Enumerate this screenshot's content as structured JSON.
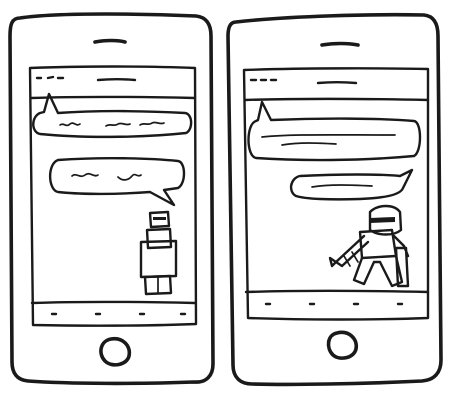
{
  "sketch": {
    "ink_color": "#1a1a1a",
    "paper_color": "#ffffff",
    "phones": [
      {
        "id": "left",
        "chat_bubbles": [
          {
            "side": "left",
            "has_scribble": true
          },
          {
            "side": "right",
            "has_scribble": true
          }
        ],
        "figure": "person-standing",
        "nav_dots": 4
      },
      {
        "id": "right",
        "chat_bubbles": [
          {
            "side": "left",
            "has_scribble": true
          },
          {
            "side": "right",
            "has_scribble": true
          }
        ],
        "figure": "person-in-motion",
        "nav_dots": 4
      }
    ]
  }
}
